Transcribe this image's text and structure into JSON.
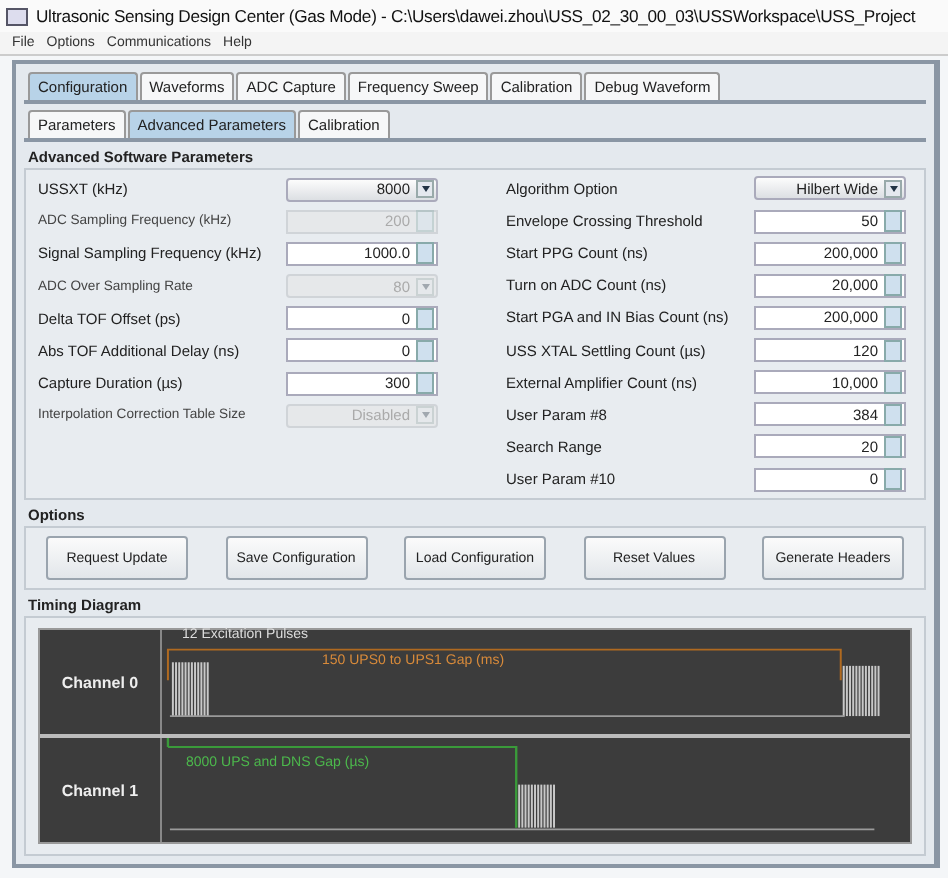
{
  "window": {
    "title": "Ultrasonic Sensing Design Center (Gas Mode) - C:\\Users\\dawei.zhou\\USS_02_30_00_03\\USSWorkspace\\USS_Project"
  },
  "menu": [
    "File",
    "Options",
    "Communications",
    "Help"
  ],
  "tabs": [
    {
      "label": "Configuration",
      "selected": true
    },
    {
      "label": "Waveforms",
      "selected": false
    },
    {
      "label": "ADC Capture",
      "selected": false
    },
    {
      "label": "Frequency Sweep",
      "selected": false
    },
    {
      "label": "Calibration",
      "selected": false
    },
    {
      "label": "Debug Waveform",
      "selected": false
    }
  ],
  "subtabs": [
    {
      "label": "Parameters",
      "selected": false
    },
    {
      "label": "Advanced Parameters",
      "selected": true
    },
    {
      "label": "Calibration",
      "selected": false
    }
  ],
  "parameters": {
    "title": "Advanced Software Parameters",
    "left": [
      {
        "label": "USSXT (kHz)",
        "kind": "combo",
        "value": "8000",
        "disabled": false
      },
      {
        "label": "ADC Sampling Frequency (kHz)",
        "kind": "spin",
        "value": "200",
        "disabled": true
      },
      {
        "label": "Signal Sampling Frequency (kHz)",
        "kind": "spin",
        "value": "1000.0",
        "disabled": false
      },
      {
        "label": "ADC Over Sampling Rate",
        "kind": "combo",
        "value": "80",
        "disabled": true
      },
      {
        "label": "Delta TOF Offset (ps)",
        "kind": "spin",
        "value": "0",
        "disabled": false
      },
      {
        "label": "Abs TOF Additional Delay (ns)",
        "kind": "spin",
        "value": "0",
        "disabled": false
      },
      {
        "label": "Capture Duration (µs)",
        "kind": "spin",
        "value": "300",
        "disabled": false
      },
      {
        "label": "Interpolation Correction Table Size",
        "kind": "combo",
        "value": "Disabled",
        "disabled": true
      }
    ],
    "right": [
      {
        "label": "Algorithm Option",
        "kind": "combo",
        "value": "Hilbert Wide",
        "disabled": false
      },
      {
        "label": "Envelope Crossing Threshold",
        "kind": "spin",
        "value": "50",
        "disabled": false
      },
      {
        "label": "Start PPG Count (ns)",
        "kind": "spin",
        "value": "200,000",
        "disabled": false
      },
      {
        "label": "Turn on ADC Count (ns)",
        "kind": "spin",
        "value": "20,000",
        "disabled": false
      },
      {
        "label": "Start PGA and IN Bias Count (ns)",
        "kind": "spin",
        "value": "200,000",
        "disabled": false
      },
      {
        "label": "USS XTAL Settling Count (µs)",
        "kind": "spin",
        "value": "120",
        "disabled": false
      },
      {
        "label": "External Amplifier Count (ns)",
        "kind": "spin",
        "value": "10,000",
        "disabled": false
      },
      {
        "label": "User Param #8",
        "kind": "spin",
        "value": "384",
        "disabled": false
      },
      {
        "label": "Search Range",
        "kind": "spin",
        "value": "20",
        "disabled": false
      },
      {
        "label": "User Param #10",
        "kind": "spin",
        "value": "0",
        "disabled": false
      }
    ]
  },
  "options": {
    "title": "Options",
    "buttons": [
      "Request Update",
      "Save Configuration",
      "Load Configuration",
      "Reset Values",
      "Generate Headers"
    ]
  },
  "timing": {
    "title": "Timing Diagram",
    "channels": [
      {
        "name": "Channel 0",
        "labels": [
          "12 Excitation Pulses",
          "150 UPS0 to UPS1 Gap (ms)"
        ]
      },
      {
        "name": "Channel 1",
        "labels": [
          "8000 UPS and DNS Gap (µs)"
        ]
      }
    ]
  }
}
